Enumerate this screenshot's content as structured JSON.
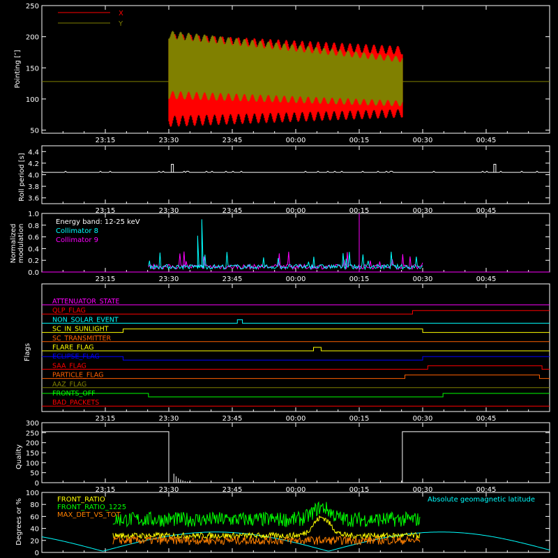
{
  "chart_data": [
    {
      "id": "pointing",
      "type": "line",
      "ylabel": "Pointing [″]",
      "ylim": [
        45,
        250
      ],
      "yticks": [
        "50",
        "100",
        "150",
        "200",
        "250"
      ],
      "xticks": [
        "23:15",
        "23:30",
        "23:45",
        "00:00",
        "00:15",
        "00:30",
        "00:45"
      ],
      "series": [
        {
          "name": "X",
          "color": "#ff0000",
          "baseline": 128,
          "active": [
            23.5,
            24.42
          ],
          "envelope_start": [
            55,
            205
          ],
          "envelope_end": [
            70,
            185
          ]
        },
        {
          "name": "Y",
          "color": "#808000",
          "baseline": 128,
          "active": [
            23.5,
            24.42
          ],
          "envelope_start": [
            100,
            210
          ],
          "envelope_end": [
            88,
            168
          ]
        }
      ]
    },
    {
      "id": "roll",
      "type": "line",
      "ylabel": "Roll period [s]",
      "ylim": [
        3.5,
        4.5
      ],
      "yticks": [
        "3.6",
        "3.8",
        "4.0",
        "4.2",
        "4.4"
      ],
      "xticks": [
        "23:15",
        "23:30",
        "23:45",
        "00:00",
        "00:15",
        "00:30",
        "00:45"
      ],
      "series": [
        {
          "name": "roll",
          "color": "#ffffff",
          "baseline": 4.04,
          "spikes": [
            [
              23.51,
              4.18
            ],
            [
              24.78,
              4.18
            ]
          ]
        }
      ]
    },
    {
      "id": "modulation",
      "type": "line",
      "ylabel": "Normalized modulation",
      "ylim": [
        0,
        1.0
      ],
      "yticks": [
        "0.0",
        "0.2",
        "0.4",
        "0.6",
        "0.8",
        "1.0"
      ],
      "xticks": [
        "23:15",
        "23:30",
        "23:45",
        "00:00",
        "00:15",
        "00:30",
        "00:45"
      ],
      "annotation": "Energy band: 12-25 keV",
      "series": [
        {
          "name": "Collimator 8",
          "color": "#00ffff",
          "active": [
            23.42,
            24.5
          ]
        },
        {
          "name": "Collimator 9",
          "color": "#ff00ff",
          "active": [
            23.42,
            24.5
          ],
          "spike": [
            24.25,
            1.0
          ]
        }
      ]
    },
    {
      "id": "flags",
      "type": "line",
      "ylabel": "Flags",
      "flags": [
        {
          "name": "ATTENUATOR_STATE",
          "color": "#ff00ff",
          "steps": []
        },
        {
          "name": "QLP_FLAG",
          "color": "#ff0000",
          "steps": [
            [
              24.46,
              1
            ]
          ]
        },
        {
          "name": "NON_SOLAR_EVENT",
          "color": "#00ffff",
          "steps": [
            [
              23.77,
              1
            ],
            [
              23.79,
              0
            ]
          ]
        },
        {
          "name": "SC_IN_SUNLIGHT",
          "color": "#ffff00",
          "steps": [
            [
              23.32,
              1
            ],
            [
              24.5,
              0
            ]
          ]
        },
        {
          "name": "SC_TRANSMITTER",
          "color": "#ff6000",
          "steps": []
        },
        {
          "name": "FLARE_FLAG",
          "color": "#ffff00",
          "steps": [
            [
              24.07,
              1
            ],
            [
              24.1,
              0
            ]
          ]
        },
        {
          "name": "ECLIPSE_FLAG",
          "color": "#0000ff",
          "steps": [
            [
              23.32,
              0
            ],
            [
              24.5,
              1
            ]
          ]
        },
        {
          "name": "SAA_FLAG",
          "color": "#ff0000",
          "steps": [
            [
              24.52,
              1
            ],
            [
              24.97,
              0
            ]
          ]
        },
        {
          "name": "PARTICLE_FLAG",
          "color": "#ff6000",
          "steps": [
            [
              24.43,
              1
            ],
            [
              24.96,
              0
            ]
          ]
        },
        {
          "name": "AAZ_FLAG",
          "color": "#808000",
          "steps": []
        },
        {
          "name": "FRONTS_OFF",
          "color": "#00ff00",
          "steps": [
            [
              23.42,
              0
            ],
            [
              24.58,
              1
            ]
          ]
        },
        {
          "name": "BAD_PACKETS",
          "color": "#ff0000",
          "steps": []
        }
      ]
    },
    {
      "id": "quality",
      "type": "line",
      "ylabel": "Quality",
      "ylim": [
        0,
        300
      ],
      "yticks": [
        "0",
        "50",
        "100",
        "150",
        "200",
        "250",
        "300"
      ],
      "xticks": [
        "23:15",
        "23:30",
        "23:45",
        "00:00",
        "00:15",
        "00:30",
        "00:45"
      ],
      "series": [
        {
          "name": "quality",
          "color": "#ffffff",
          "segments": [
            [
              23.1,
              23.5,
              255
            ],
            [
              24.42,
              25.0,
              255
            ]
          ]
        }
      ]
    },
    {
      "id": "geo",
      "type": "line",
      "ylabel": "Degrees or %",
      "ylim": [
        0,
        100
      ],
      "yticks": [
        "0",
        "20",
        "40",
        "60",
        "80",
        "100"
      ],
      "annotation": "Absolute geomagnetic latitude",
      "series": [
        {
          "name": "FRONT_RATIO",
          "color": "#ffff00"
        },
        {
          "name": "FRONT_RATIO_1225",
          "color": "#00ff00"
        },
        {
          "name": "MAX_DET_VS_TOT",
          "color": "#ff8000"
        }
      ]
    }
  ]
}
